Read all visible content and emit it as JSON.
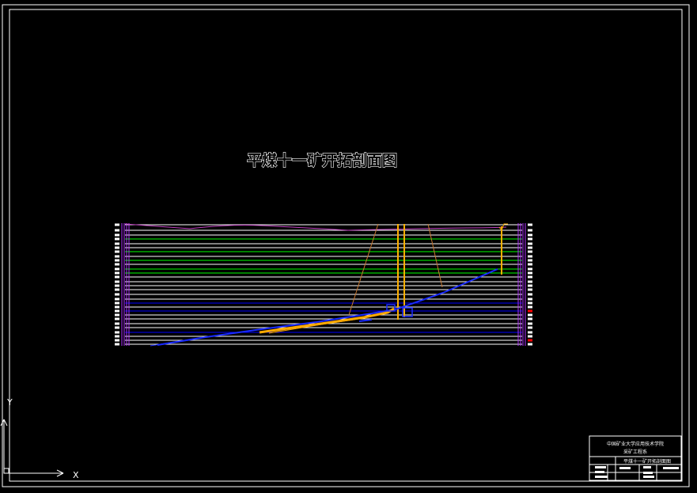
{
  "drawing": {
    "title": "平煤十一矿开拓剖面图",
    "background": "#000000",
    "frame_color": "#ffffff"
  },
  "title_block": {
    "line1": "中国矿业大学应用技术学院",
    "line2": "采矿工程系",
    "drawing_name": "平煤十一矿开拓剖面图"
  },
  "ucs": {
    "x_label": "X",
    "y_label": "Y"
  },
  "colors": {
    "strata_white": "#ffffff",
    "strata_green": "#00ff00",
    "strata_blue": "#0000ff",
    "seam_blue": "#1a2bff",
    "seam_orange": "#ffaa00",
    "shaft_orange": "#ffb000",
    "fault_brown": "#c87830",
    "surface_magenta": "#c040c0",
    "border_magenta": "#b030ff",
    "marker_red": "#ff0000"
  }
}
